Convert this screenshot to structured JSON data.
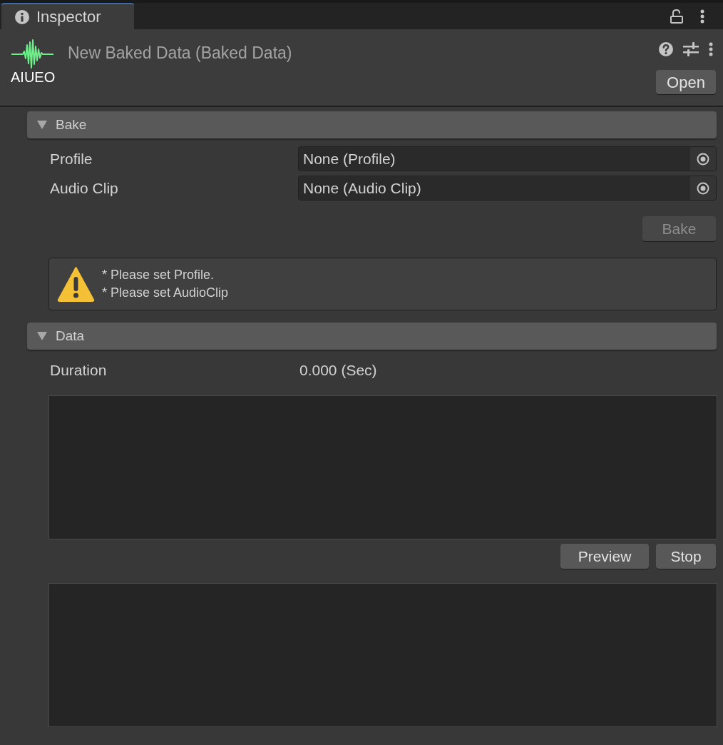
{
  "tab": {
    "title": "Inspector",
    "selected": true
  },
  "header": {
    "logo_text": "AIUEO",
    "title": "New Baked Data (Baked Data)",
    "open_button": "Open"
  },
  "sections": [
    {
      "title": "Bake",
      "expanded": true,
      "items": [
        {
          "kind": "object_field",
          "label": "Profile",
          "value": "None (Profile)"
        },
        {
          "kind": "object_field",
          "label": "Audio Clip",
          "value": "None (Audio Clip)"
        },
        {
          "kind": "button",
          "label": "Bake",
          "disabled": true
        },
        {
          "kind": "warning",
          "lines": [
            "* Please set Profile.",
            "* Please set AudioClip"
          ]
        }
      ]
    },
    {
      "title": "Data",
      "expanded": true,
      "items": [
        {
          "kind": "value_row",
          "label": "Duration",
          "value": "0.000 (Sec)"
        },
        {
          "kind": "panel"
        },
        {
          "kind": "buttons",
          "buttons": [
            {
              "label": "Preview",
              "disabled": false
            },
            {
              "label": "Stop",
              "disabled": false
            }
          ]
        },
        {
          "kind": "panel"
        }
      ]
    }
  ]
}
